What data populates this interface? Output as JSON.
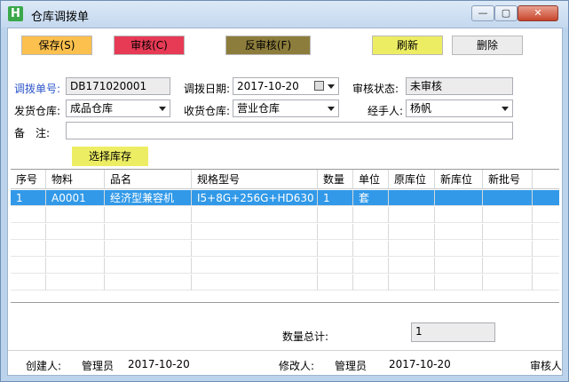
{
  "window": {
    "icon_letter": "H",
    "title": "仓库调拨单",
    "minimize": "—",
    "maximize": "▢",
    "close": "✕"
  },
  "toolbar": {
    "save": "保存(S)",
    "audit": "审核(C)",
    "unaudit": "反审核(F)",
    "refresh": "刷新",
    "delete": "删除"
  },
  "form": {
    "doc_no_label": "调拨单号:",
    "doc_no": "DB171020001",
    "date_label": "调拨日期:",
    "date": "2017-10-20",
    "status_label": "审核状态:",
    "status": "未审核",
    "from_label": "发货仓库:",
    "from": "成品仓库",
    "to_label": "收货仓库:",
    "to": "营业仓库",
    "handler_label": "经手人:",
    "handler": "杨帆",
    "remark_label": "备　注:",
    "remark": "",
    "select_stock": "选择库存"
  },
  "table": {
    "headers": [
      "序号",
      "物料",
      "品名",
      "规格型号",
      "数量",
      "单位",
      "原库位",
      "新库位",
      "新批号"
    ],
    "rows": [
      [
        "1",
        "A0001",
        "经济型兼容机",
        "I5+8G+256G+HD630",
        "1",
        "套",
        "",
        "",
        ""
      ]
    ]
  },
  "summary": {
    "qty_total_label": "数量总计:",
    "qty_total": "1"
  },
  "footer": {
    "creator_label": "创建人:",
    "creator": "管理员",
    "created_date": "2017-10-20",
    "modifier_label": "修改人:",
    "modifier": "管理员",
    "modified_date": "2017-10-20",
    "auditor_label": "审核人"
  },
  "colors": {
    "save": "#fcc04e",
    "audit": "#e73a55",
    "unaudit": "#8d7d3c",
    "refresh": "#eded64",
    "selected_row": "#3199e8"
  }
}
